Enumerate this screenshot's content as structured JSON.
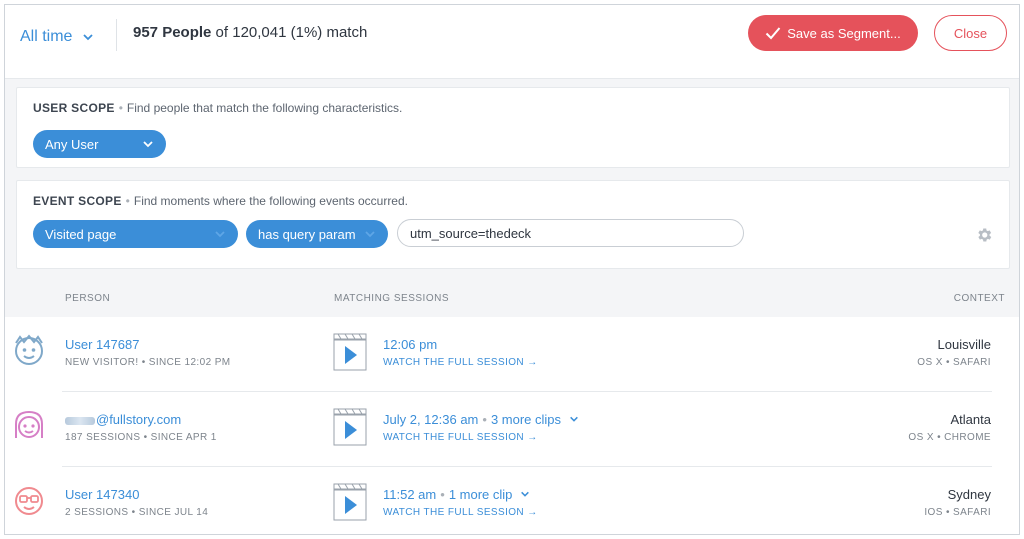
{
  "topbar": {
    "time_range": "All time",
    "match_count": "957 People",
    "match_rest": " of 120,041 (1%) match",
    "save_label": "Save as Segment...",
    "close_label": "Close"
  },
  "user_scope": {
    "title": "USER SCOPE",
    "description": "Find people that match the following characteristics.",
    "selector": "Any User"
  },
  "event_scope": {
    "title": "EVENT SCOPE",
    "description": "Find moments where the following events occurred.",
    "event": "Visited page",
    "operator": "has query param",
    "value": "utm_source=thedeck"
  },
  "table": {
    "headers": {
      "person": "PERSON",
      "sessions": "MATCHING SESSIONS",
      "context": "CONTEXT"
    },
    "rows": [
      {
        "name": "User 147687",
        "meta": "NEW VISITOR! • SINCE 12:02 PM",
        "time": "12:06 pm",
        "more": "",
        "watch": "WATCH THE FULL SESSION →",
        "city": "Louisville",
        "os": "OS X • SAFARI",
        "avatar_color": "#7fa8c9"
      },
      {
        "name": "@fullstory.com",
        "meta": "187 SESSIONS • SINCE APR 1",
        "time": "July 2, 12:36 am",
        "more": "3 more clips",
        "watch": "WATCH THE FULL SESSION →",
        "city": "Atlanta",
        "os": "OS X • CHROME",
        "avatar_color": "#d67fc6"
      },
      {
        "name": "User 147340",
        "meta": "2 SESSIONS • SINCE JUL 14",
        "time": "11:52 am",
        "more": "1 more clip",
        "watch": "WATCH THE FULL SESSION →",
        "city": "Sydney",
        "os": "IOS • SAFARI",
        "avatar_color": "#f08a8f"
      }
    ]
  },
  "colors": {
    "accent": "#3b8ed8",
    "danger": "#e5525b"
  }
}
